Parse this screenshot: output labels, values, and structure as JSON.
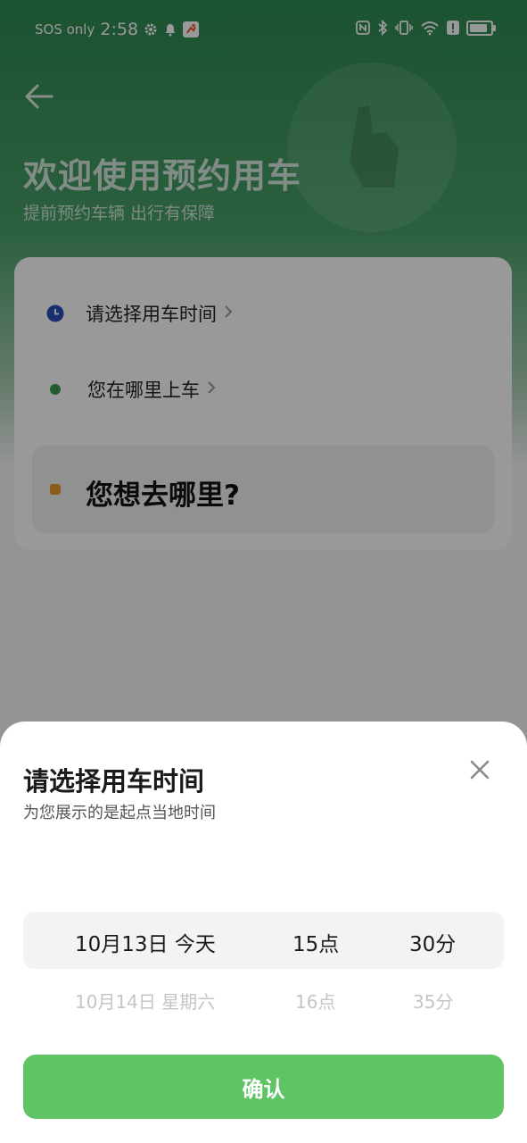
{
  "status_bar": {
    "sos": "SOS only",
    "time": "2:58",
    "battery_level": 0.74
  },
  "hero": {
    "title": "欢迎使用预约用车",
    "subtitle": "提前预约车辆 出行有保障"
  },
  "booking_card": {
    "time_label": "请选择用车时间",
    "pickup_label": "您在哪里上车",
    "destination_label": "您想去哪里?"
  },
  "sheet": {
    "title": "请选择用车时间",
    "subtitle": "为您展示的是起点当地时间",
    "picker": {
      "selected": {
        "date": "10月13日 今天",
        "hour": "15点",
        "minute": "30分"
      },
      "next": {
        "date": "10月14日 星期六",
        "hour": "16点",
        "minute": "35分"
      }
    },
    "confirm_label": "确认"
  },
  "colors": {
    "accent_green": "#5fc463",
    "header_green": "#2f8a52",
    "clock_icon_blue": "#2b4db8",
    "pickup_dot_green": "#3a9a4e",
    "destination_dot_orange": "#e59a2c"
  },
  "icons": [
    "back-arrow-icon",
    "clock-icon",
    "chevron-right-icon",
    "close-icon",
    "gear-icon",
    "bell-icon",
    "nfc-icon",
    "bluetooth-icon",
    "vibrate-icon",
    "wifi-icon",
    "alert-icon",
    "battery-icon"
  ]
}
